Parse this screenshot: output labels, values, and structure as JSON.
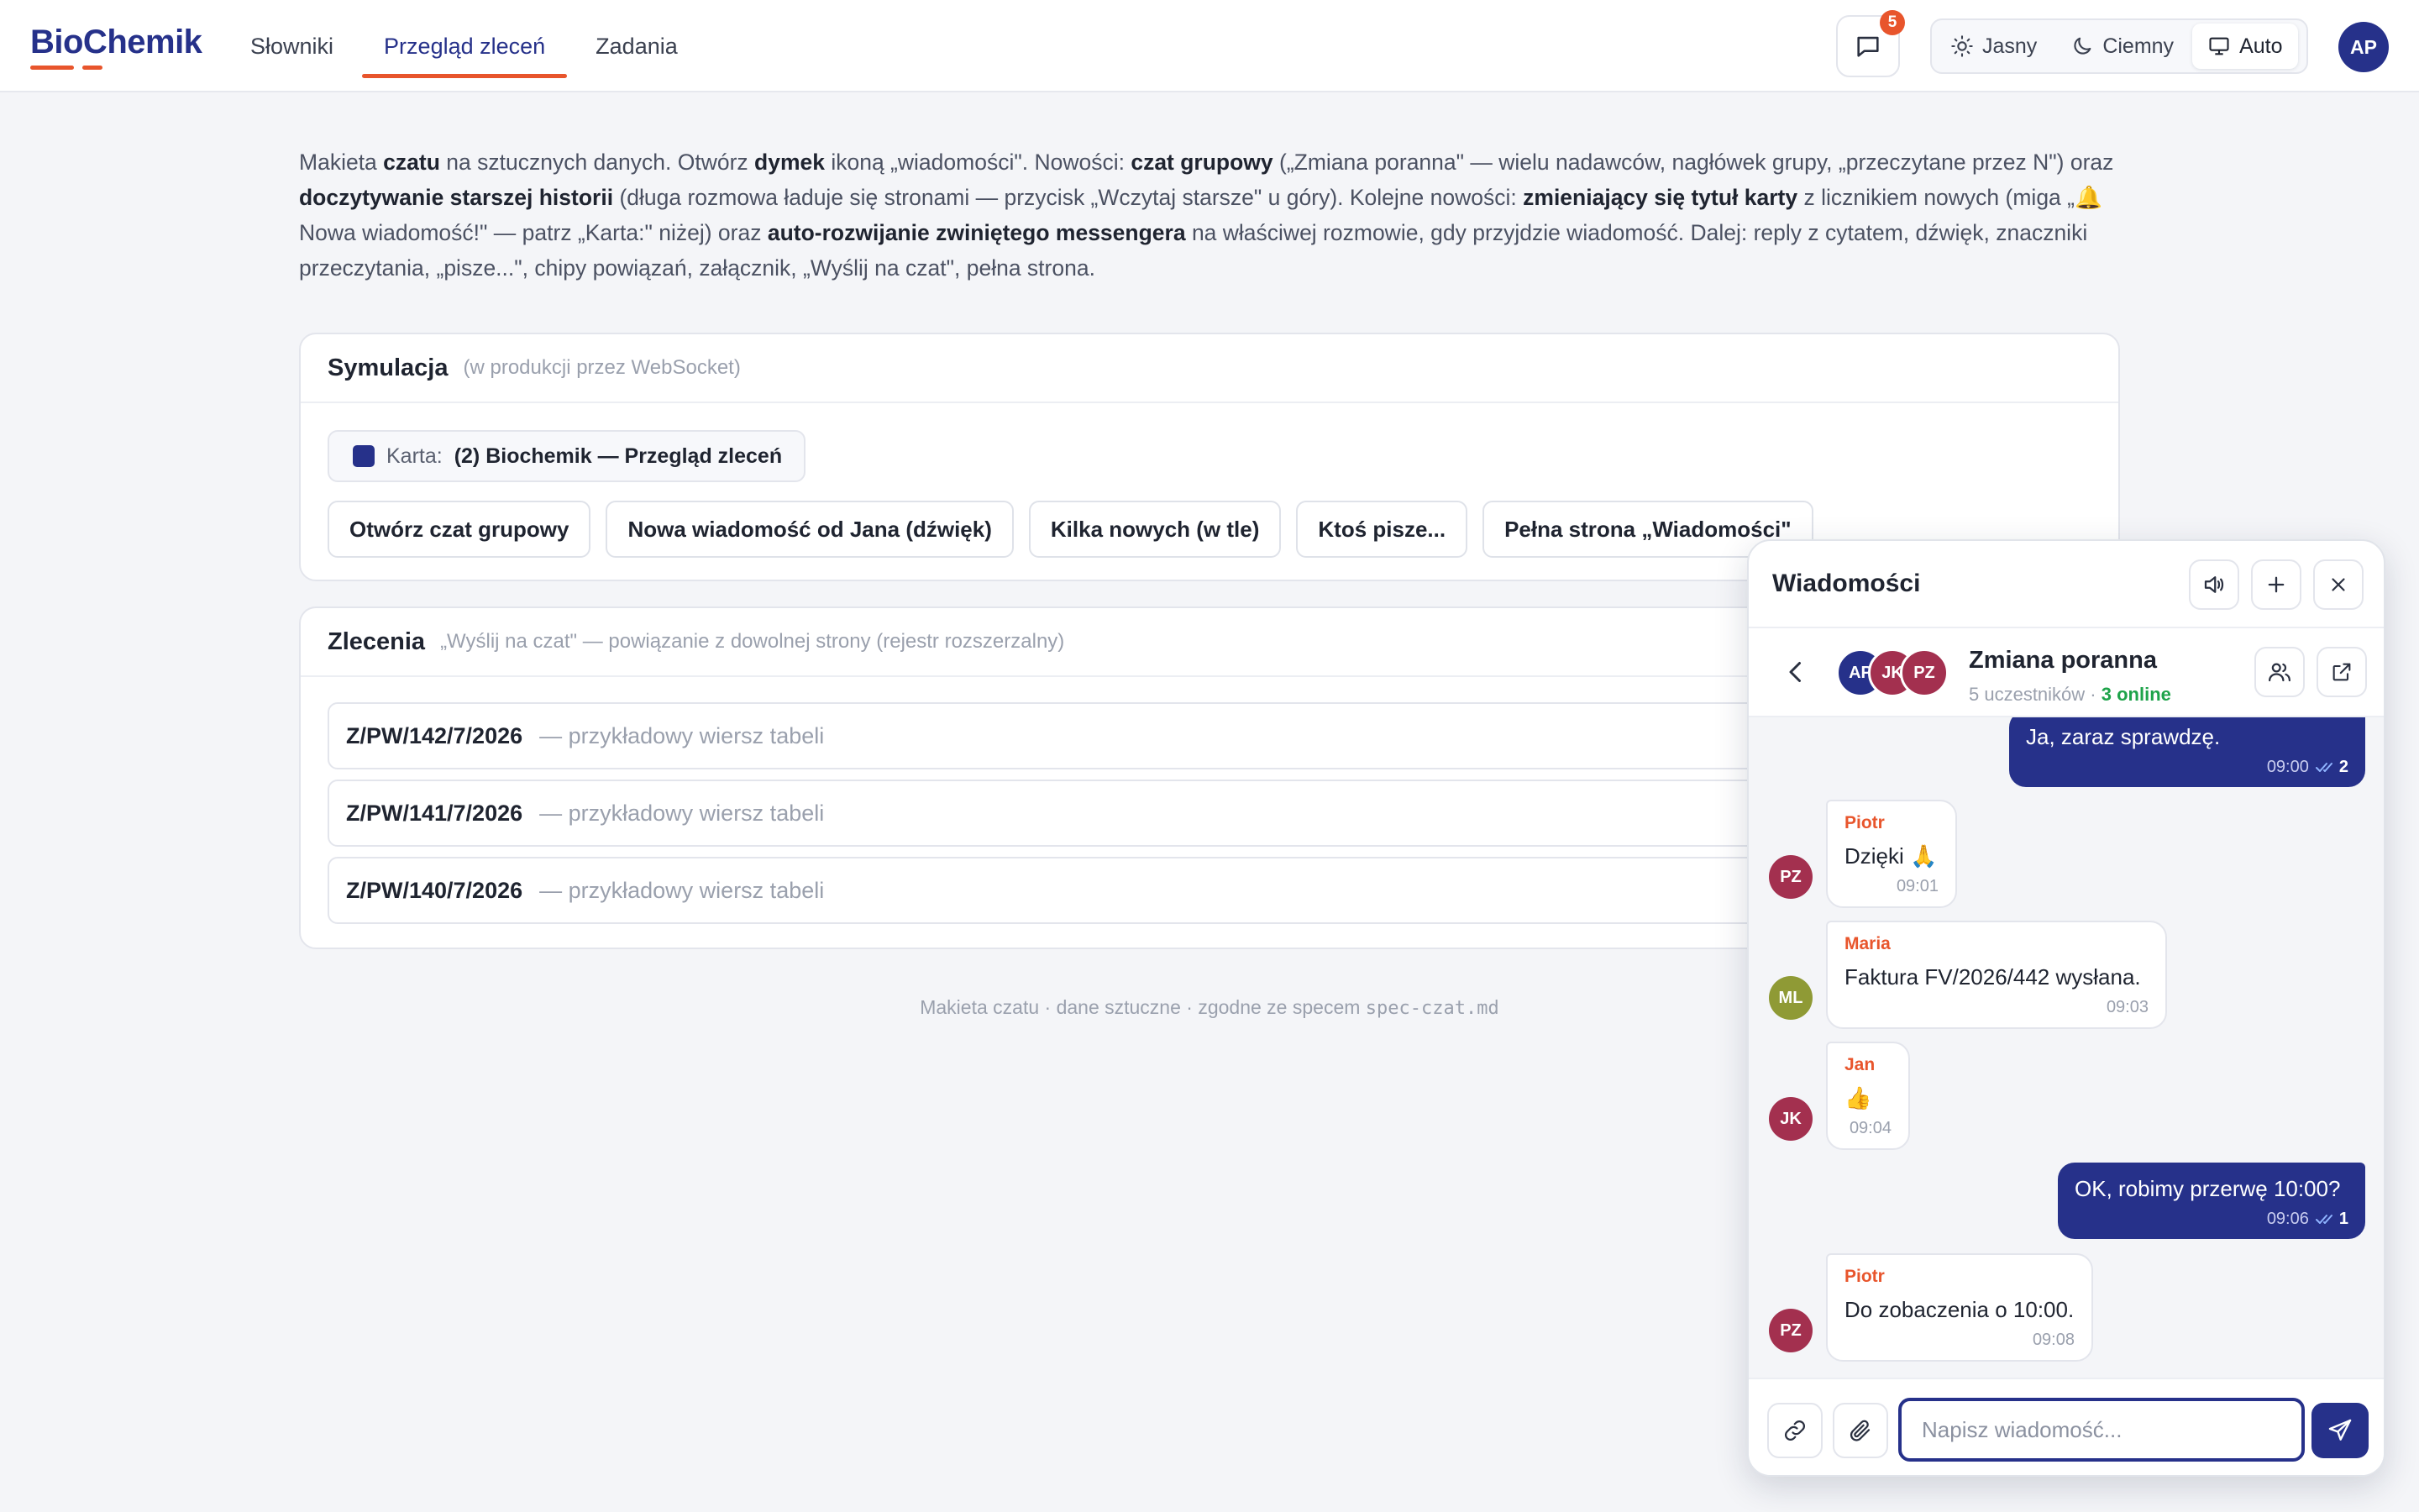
{
  "app": {
    "logo": "BioChemik",
    "colors": {
      "brand": "#26318a",
      "accent": "#e8552c",
      "online": "#1ea34a"
    }
  },
  "nav": {
    "items": [
      {
        "label": "Słowniki"
      },
      {
        "label": "Przegląd zleceń",
        "active": true
      },
      {
        "label": "Zadania"
      }
    ]
  },
  "header": {
    "messages_icon": "chat-bubble-icon",
    "unread_badge": "5",
    "theme": {
      "light": "Jasny",
      "dark": "Ciemny",
      "auto": "Auto",
      "selected": "Auto"
    },
    "user_initials": "AP"
  },
  "intro": {
    "p1": "Makieta ",
    "b1": "czatu",
    "p2": " na sztucznych danych. Otwórz ",
    "b2": "dymek",
    "p3": " ikoną „wiadomości\". Nowości: ",
    "b3": "czat grupowy",
    "p4": " („Zmiana poranna\" — wielu nadawców, nagłówek grupy, „przeczytane przez N\") oraz ",
    "b4": "doczytywanie starszej historii",
    "p5": " (długa rozmowa ładuje się stronami — przycisk „Wczytaj starsze\" u góry). Kolejne nowości: ",
    "b5": "zmieniający się tytuł karty",
    "p6": " z licznikiem nowych (miga „🔔 Nowa wiadomość!\" — patrz „Karta:\" niżej) oraz ",
    "b6": "auto-rozwijanie zwiniętego messengera",
    "p7": " na właściwej rozmowie, gdy przyjdzie wiadomość. Dalej: reply z cytatem, dźwięk, znaczniki przeczytania, „pisze...\", chipy powiązań, załącznik, „Wyślij na czat\", pełna strona."
  },
  "simulation": {
    "title": "Symulacja",
    "subtitle": "(w produkcji przez WebSocket)",
    "tab_label": "Karta:",
    "tab_value": "(2) Biochemik — Przegląd zleceń",
    "buttons": [
      "Otwórz czat grupowy",
      "Nowa wiadomość od Jana (dźwięk)",
      "Kilka nowych (w tle)",
      "Ktoś pisze...",
      "Pełna strona „Wiadomości\""
    ]
  },
  "orders": {
    "title": "Zlecenia",
    "subtitle": "„Wyślij na czat\" — powiązanie z dowolnej strony (rejestr rozszerzalny)",
    "rows": [
      {
        "id": "Z/PW/142/7/2026",
        "desc": "— przykładowy wiersz tabeli"
      },
      {
        "id": "Z/PW/141/7/2026",
        "desc": "— przykładowy wiersz tabeli"
      },
      {
        "id": "Z/PW/140/7/2026",
        "desc": "— przykładowy wiersz tabeli"
      }
    ]
  },
  "footer": {
    "text": "Makieta czatu · dane sztuczne · zgodne ze specem ",
    "code": "spec-czat.md"
  },
  "messenger": {
    "title": "Wiadomości",
    "conversation": {
      "name": "Zmiana poranna",
      "participants": "5 uczestników",
      "separator": " · ",
      "online": "3 online",
      "avatars": [
        {
          "initials": "AP",
          "color": "#26318a"
        },
        {
          "initials": "JK",
          "color": "#a3304f"
        },
        {
          "initials": "PZ",
          "color": "#a3304f"
        }
      ]
    },
    "messages": [
      {
        "dir": "out",
        "text": "Ja, zaraz sprawdzę.",
        "time": "09:00",
        "reads": "2"
      },
      {
        "dir": "in",
        "sender": "Piotr",
        "initials": "PZ",
        "avatar_color": "#a3304f",
        "text": "Dzięki 🙏",
        "time": "09:01"
      },
      {
        "dir": "in",
        "sender": "Maria",
        "initials": "ML",
        "avatar_color": "#8f9a35",
        "text": "Faktura FV/2026/442 wysłana.",
        "time": "09:03"
      },
      {
        "dir": "in",
        "sender": "Jan",
        "initials": "JK",
        "avatar_color": "#a3304f",
        "text": "👍",
        "time": "09:04"
      },
      {
        "dir": "out",
        "text": "OK, robimy przerwę 10:00?",
        "time": "09:06",
        "reads": "1"
      },
      {
        "dir": "in",
        "sender": "Piotr",
        "initials": "PZ",
        "avatar_color": "#a3304f",
        "text": "Do zobaczenia o 10:00.",
        "time": "09:08"
      }
    ],
    "composer": {
      "placeholder": "Napisz wiadomość..."
    }
  }
}
